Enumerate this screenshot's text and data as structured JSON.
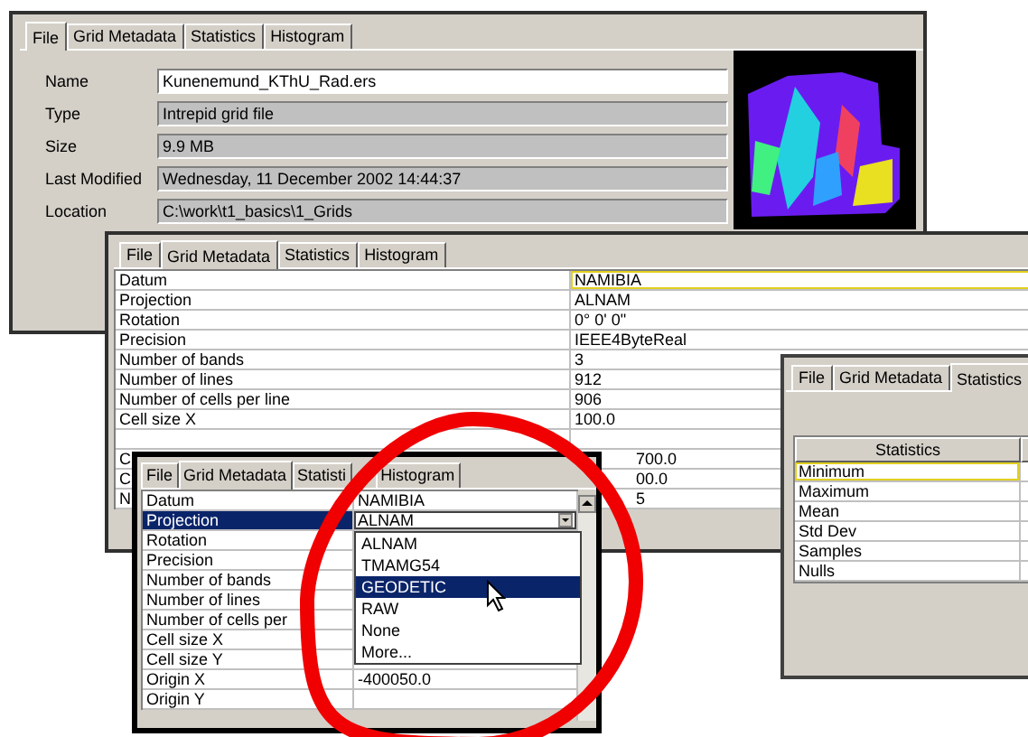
{
  "windows": [
    {
      "kind": "file",
      "tabs": [
        {
          "label": "File",
          "selected": true
        },
        {
          "label": "Grid Metadata",
          "selected": false
        },
        {
          "label": "Statistics",
          "selected": false
        },
        {
          "label": "Histogram",
          "selected": false
        }
      ],
      "fields": [
        {
          "label": "Name",
          "value": "Kunenemund_KThU_Rad.ers",
          "editable": true
        },
        {
          "label": "Type",
          "value": "Intrepid grid file",
          "editable": false
        },
        {
          "label": "Size",
          "value": "9.9 MB",
          "editable": false
        },
        {
          "label": "Last Modified",
          "value": "Wednesday, 11 December 2002 14:44:37",
          "editable": false
        },
        {
          "label": "Location",
          "value": "C:\\work\\t1_basics\\1_Grids",
          "editable": false
        }
      ]
    },
    {
      "kind": "metadata",
      "tabs": [
        {
          "label": "File",
          "selected": false
        },
        {
          "label": "Grid Metadata",
          "selected": true
        },
        {
          "label": "Statistics",
          "selected": false
        },
        {
          "label": "Histogram",
          "selected": false
        }
      ],
      "rows": [
        {
          "kind": "full",
          "label": "Datum",
          "value": "NAMIBIA",
          "focused": true,
          "selected": false
        },
        {
          "kind": "full",
          "label": "Projection",
          "value": "ALNAM",
          "focused": false,
          "selected": false
        },
        {
          "kind": "full",
          "label": "Rotation",
          "value": "0° 0' 0\"",
          "focused": false,
          "selected": false
        },
        {
          "kind": "full",
          "label": "Precision",
          "value": "IEEE4ByteReal",
          "focused": false,
          "selected": false
        },
        {
          "kind": "full",
          "label": "Number of bands",
          "value": "3",
          "focused": false,
          "selected": false
        },
        {
          "kind": "full",
          "label": "Number of lines",
          "value": "912",
          "focused": false,
          "selected": false
        },
        {
          "kind": "full",
          "label": "Number of cells per line",
          "value": "906",
          "focused": false,
          "selected": false
        },
        {
          "kind": "full",
          "label": "Cell size X",
          "value": "100.0",
          "focused": false,
          "selected": false
        },
        {
          "kind": "covered",
          "label": "C",
          "value": "700.0",
          "focused": false,
          "selected": false
        },
        {
          "kind": "covered",
          "label": "C",
          "value": "00.0",
          "focused": false,
          "selected": false
        },
        {
          "kind": "covered",
          "label": "N",
          "value": "5",
          "focused": false,
          "selected": false
        }
      ]
    },
    {
      "kind": "statistics",
      "tabs": [
        {
          "label": "File",
          "selected": false
        },
        {
          "label": "Grid Metadata",
          "selected": false
        },
        {
          "label": "Statistics",
          "selected": true
        }
      ],
      "columns": [
        "Statistics"
      ],
      "rows": [
        {
          "label": "Minimum",
          "focused": true
        },
        {
          "label": "Maximum",
          "focused": false
        },
        {
          "label": "Mean",
          "focused": false
        },
        {
          "label": "Std Dev",
          "focused": false
        },
        {
          "label": "Samples",
          "focused": false
        },
        {
          "label": "Nulls",
          "focused": false
        }
      ]
    },
    {
      "kind": "metadata",
      "tabs": [
        {
          "label": "File",
          "selected": false
        },
        {
          "label": "Grid Metadata",
          "selected": true
        },
        {
          "label": "Statisti",
          "selected": false
        },
        {
          "label": "Histogram",
          "selected": false
        }
      ],
      "rows": [
        {
          "kind": "full",
          "label": "Datum",
          "value": "NAMIBIA",
          "selected": false
        },
        {
          "kind": "combo",
          "label": "Projection",
          "value": "ALNAM",
          "selected": true,
          "dropdown": {
            "options": [
              {
                "label": "ALNAM",
                "selected": false
              },
              {
                "label": "TMAMG54",
                "selected": false
              },
              {
                "label": "GEODETIC",
                "selected": true
              },
              {
                "label": "RAW",
                "selected": false
              },
              {
                "label": "None",
                "selected": false
              },
              {
                "label": "More...",
                "selected": false
              }
            ]
          }
        },
        {
          "kind": "full",
          "label": "Rotation",
          "selected": false
        },
        {
          "kind": "full",
          "label": "Precision",
          "selected": false
        },
        {
          "kind": "full",
          "label": "Number of bands",
          "selected": false
        },
        {
          "kind": "full",
          "label": "Number of lines",
          "selected": false
        },
        {
          "kind": "full",
          "label": "Number of cells per",
          "selected": false
        },
        {
          "kind": "full",
          "label": "Cell size X",
          "selected": false
        },
        {
          "kind": "full",
          "label": "Cell size Y",
          "selected": false
        },
        {
          "kind": "full",
          "label": "Origin X",
          "value": "-400050.0",
          "selected": false
        },
        {
          "kind": "full",
          "label": "Origin Y",
          "selected": false
        }
      ]
    }
  ]
}
